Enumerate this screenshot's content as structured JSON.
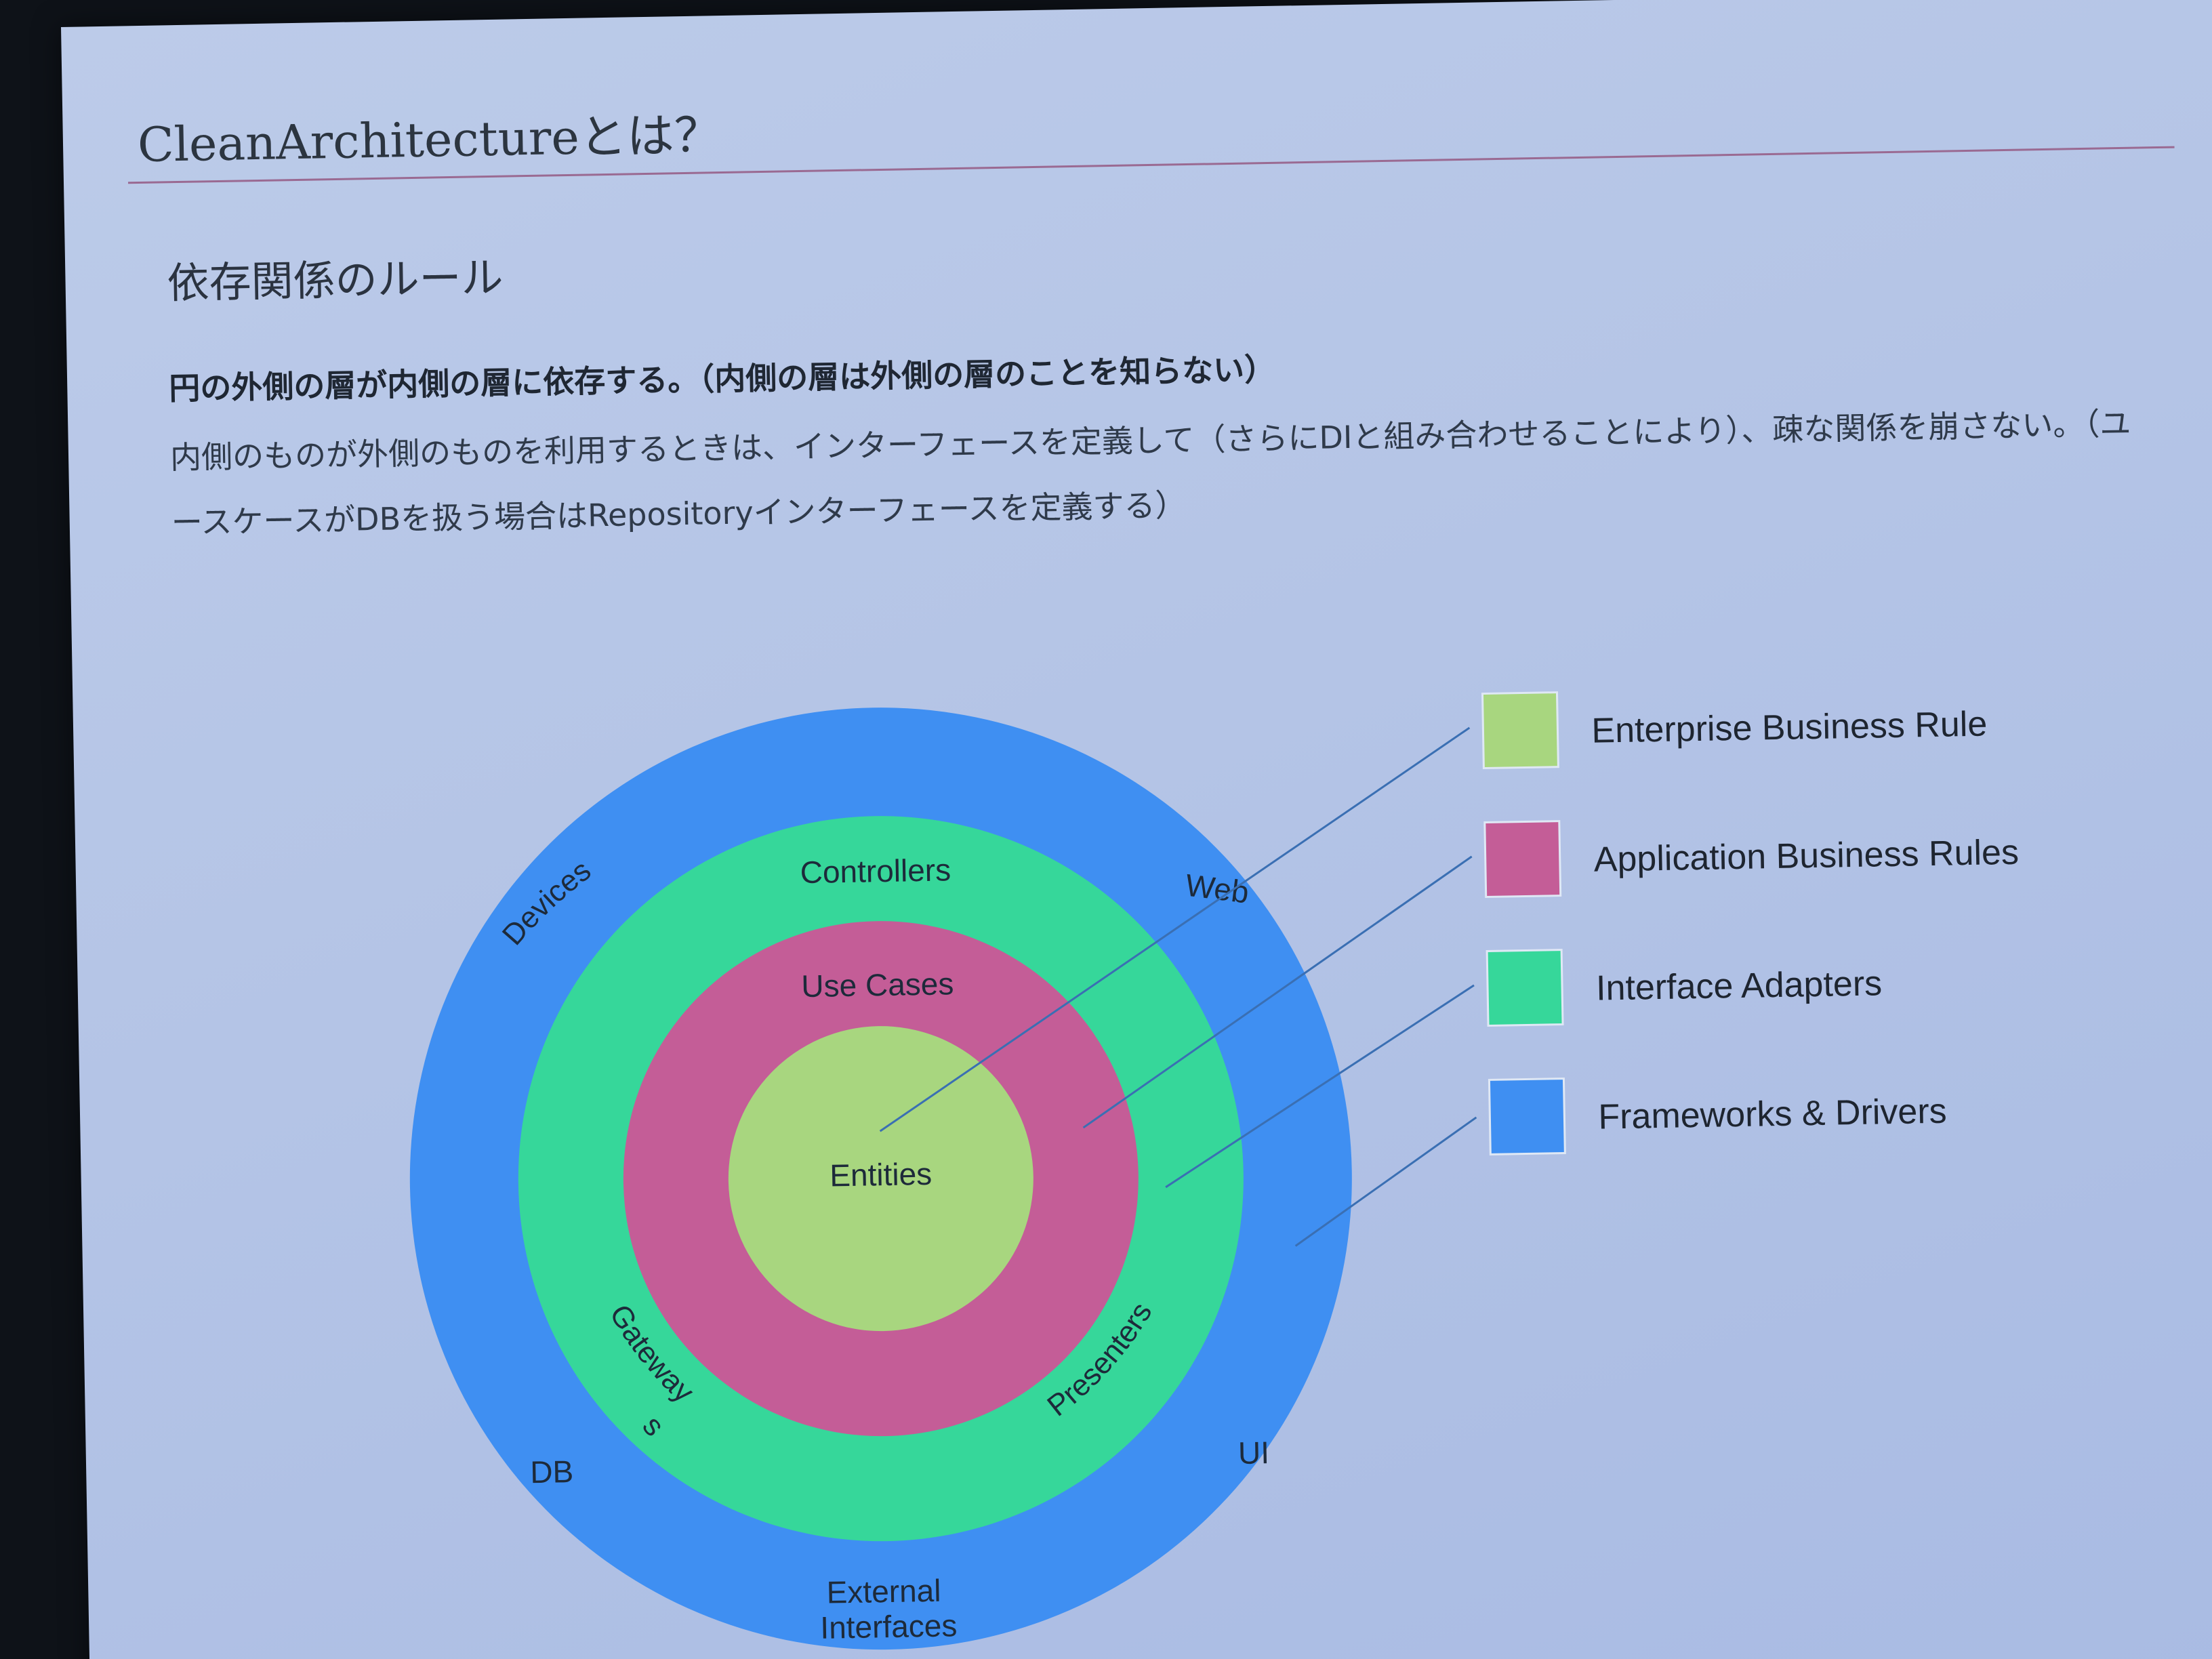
{
  "slide": {
    "title": "CleanArchitectureとは？",
    "subtitle": "依存関係のルール",
    "lead": "円の外側の層が内側の層に依存する。（内側の層は外側の層のことを知らない）",
    "body": "内側のものが外側のものを利用するときは、インターフェースを定義して（さらにDIと組み合わせることにより）、疎な関係を崩さない。（ユースケースがDBを扱う場合はRepositoryインターフェースを定義する）"
  },
  "diagram": {
    "rings": {
      "frameworks": {
        "color": "#3f8ff2",
        "labels": {
          "devices": "Devices",
          "web": "Web",
          "db": "DB",
          "ui": "UI",
          "external_line1": "External",
          "external_line2": "Interfaces"
        }
      },
      "adapters": {
        "color": "#36d79a",
        "labels": {
          "controllers": "Controllers",
          "gateways_line1": "Gateway",
          "gateways_line2": "s",
          "presenters": "Presenters"
        }
      },
      "usecases": {
        "color": "#c45d97",
        "labels": {
          "usecases": "Use Cases"
        }
      },
      "entities": {
        "color": "#a8d67f",
        "labels": {
          "entities": "Entities"
        }
      }
    },
    "legend": [
      {
        "label": "Enterprise Business Rule",
        "color": "#a8d67f"
      },
      {
        "label": "Application Business Rules",
        "color": "#c45d97"
      },
      {
        "label": "Interface Adapters",
        "color": "#36d79a"
      },
      {
        "label": "Frameworks & Drivers",
        "color": "#3f8ff2"
      }
    ]
  }
}
